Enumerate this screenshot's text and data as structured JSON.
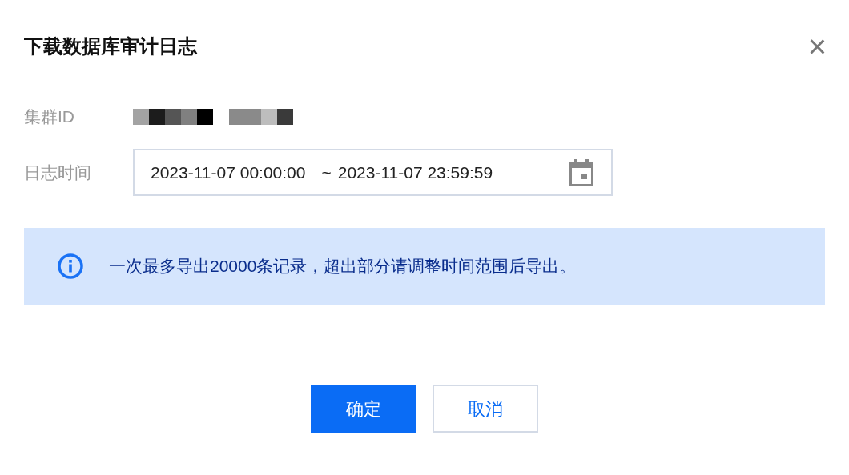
{
  "dialog": {
    "title": "下载数据库审计日志",
    "close": "×"
  },
  "fields": [
    {
      "label": "集群ID",
      "kind": "redacted"
    },
    {
      "label": "日志时间",
      "kind": "daterange",
      "start": "2023-11-07 00:00:00",
      "separator": "~",
      "end": "2023-11-07 23:59:59"
    }
  ],
  "notice": {
    "text": "一次最多导出20000条记录，超出部分请调整时间范围后导出。"
  },
  "buttons": [
    {
      "label": "确定",
      "kind": "primary"
    },
    {
      "label": "取消",
      "kind": "secondary"
    }
  ]
}
